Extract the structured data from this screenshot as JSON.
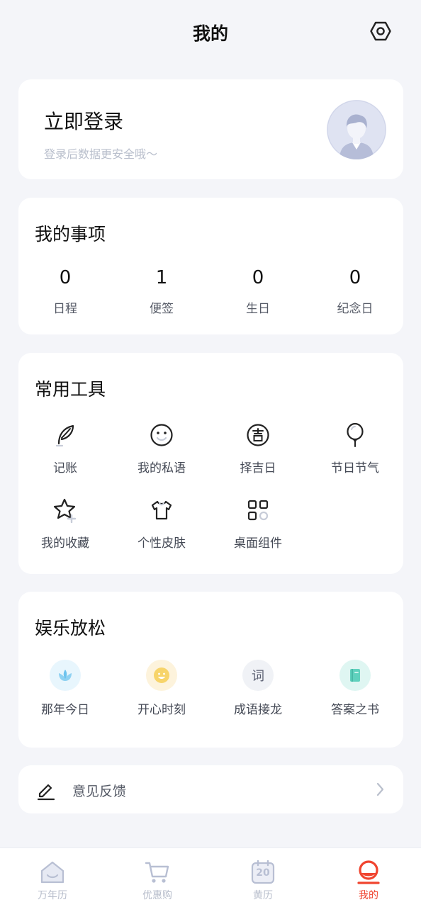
{
  "header": {
    "title": "我的",
    "settings_icon": "settings-hexagon-icon"
  },
  "login": {
    "title": "立即登录",
    "subtitle": "登录后数据更安全哦～",
    "avatar_icon": "avatar-icon"
  },
  "matters": {
    "title": "我的事项",
    "items": [
      {
        "count": "0",
        "label": "日程"
      },
      {
        "count": "1",
        "label": "便签"
      },
      {
        "count": "0",
        "label": "生日"
      },
      {
        "count": "0",
        "label": "纪念日"
      }
    ]
  },
  "tools": {
    "title": "常用工具",
    "items": [
      {
        "label": "记账",
        "icon": "feather-icon"
      },
      {
        "label": "我的私语",
        "icon": "smile-icon"
      },
      {
        "label": "择吉日",
        "icon": "auspicious-icon"
      },
      {
        "label": "节日节气",
        "icon": "balloon-icon"
      },
      {
        "label": "我的收藏",
        "icon": "star-plus-icon"
      },
      {
        "label": "个性皮肤",
        "icon": "tshirt-icon"
      },
      {
        "label": "桌面组件",
        "icon": "widgets-icon"
      }
    ]
  },
  "fun": {
    "title": "娱乐放松",
    "items": [
      {
        "label": "那年今日",
        "icon": "lotus-icon",
        "color": "#e8f6fd"
      },
      {
        "label": "开心时刻",
        "icon": "happy-face-icon",
        "color": "#fdf3dc"
      },
      {
        "label": "成语接龙",
        "icon": "word-icon",
        "glyph": "词",
        "color": "#f0f2f6"
      },
      {
        "label": "答案之书",
        "icon": "book-icon",
        "color": "#dff6f2"
      }
    ]
  },
  "feedback": {
    "label": "意见反馈",
    "icon": "edit-icon",
    "chevron_icon": "chevron-right-icon"
  },
  "tabbar": {
    "accent": "#f0442f",
    "items": [
      {
        "label": "万年历",
        "icon": "home-icon"
      },
      {
        "label": "优惠购",
        "icon": "cart-icon"
      },
      {
        "label": "黄历",
        "icon": "calendar-icon",
        "day": "20"
      },
      {
        "label": "我的",
        "icon": "profile-icon",
        "active": true
      }
    ]
  }
}
